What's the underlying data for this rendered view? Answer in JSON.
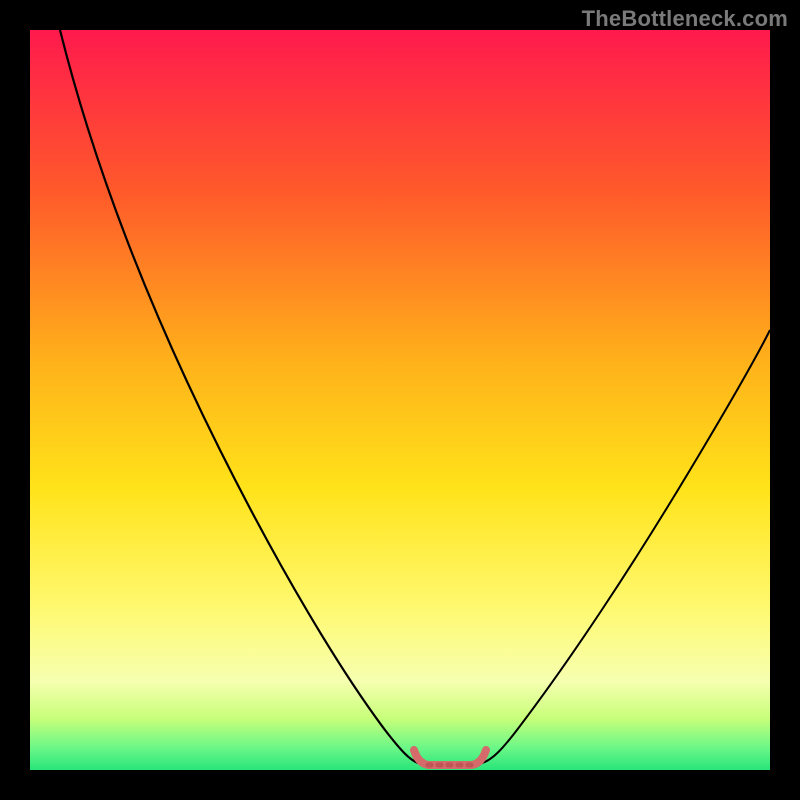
{
  "watermark": "TheBottleneck.com",
  "colors": {
    "frame": "#000000",
    "gradient_top": "#ff1a4d",
    "gradient_mid1": "#ff7a1f",
    "gradient_mid2": "#ffd21a",
    "gradient_mid3": "#fff99a",
    "gradient_bottom1": "#b6ff6a",
    "gradient_bottom2": "#35ee83",
    "curve": "#000000",
    "flat_segment": "#d46a6a"
  },
  "chart_data": {
    "type": "line",
    "title": "",
    "xlabel": "",
    "ylabel": "",
    "xlim": [
      0,
      100
    ],
    "ylim": [
      0,
      100
    ],
    "series": [
      {
        "name": "bottleneck-curve",
        "x": [
          0,
          5,
          10,
          15,
          20,
          25,
          30,
          35,
          40,
          45,
          48,
          52,
          55,
          58,
          60,
          65,
          70,
          75,
          80,
          85,
          90,
          95,
          100
        ],
        "y": [
          100,
          93,
          85,
          76,
          67,
          58,
          49,
          39,
          29,
          18,
          10,
          3,
          2,
          2,
          3,
          9,
          17,
          25,
          33,
          41,
          49,
          55,
          60
        ]
      },
      {
        "name": "flat-zone",
        "x": [
          48,
          50,
          52,
          54,
          56,
          58,
          60
        ],
        "y": [
          3.0,
          2.3,
          2.0,
          2.0,
          2.0,
          2.3,
          3.0
        ]
      }
    ],
    "notes": "Vertical gradient background transitions from red (high bottleneck) at top to green (low bottleneck) at bottom. Black V-shaped curve reaches near zero around x≈55 with a short flat red-highlighted segment at the trough."
  }
}
